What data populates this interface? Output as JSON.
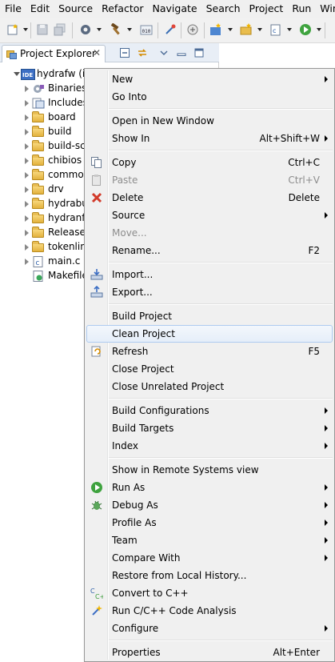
{
  "menubar": [
    "File",
    "Edit",
    "Source",
    "Refactor",
    "Navigate",
    "Search",
    "Project",
    "Run",
    "Window"
  ],
  "explorer": {
    "tab_label": "Project Explorer",
    "close_glyph": "✕",
    "tree": [
      {
        "label": "hydrafw (in",
        "icon": "c-project-icon",
        "level": 0,
        "open": true
      },
      {
        "label": "Binaries",
        "icon": "binaries-icon",
        "level": 1
      },
      {
        "label": "Includes",
        "icon": "includes-icon",
        "level": 1
      },
      {
        "label": "board",
        "icon": "folder-icon",
        "level": 1
      },
      {
        "label": "build",
        "icon": "folder-icon",
        "level": 1
      },
      {
        "label": "build-sc",
        "icon": "folder-icon",
        "level": 1
      },
      {
        "label": "chibios",
        "icon": "folder-icon",
        "level": 1
      },
      {
        "label": "commor",
        "icon": "folder-icon",
        "level": 1
      },
      {
        "label": "drv",
        "icon": "folder-icon",
        "level": 1
      },
      {
        "label": "hydrabu",
        "icon": "folder-icon",
        "level": 1
      },
      {
        "label": "hydranfc",
        "icon": "folder-icon",
        "level": 1
      },
      {
        "label": "Release",
        "icon": "folder-icon",
        "level": 1
      },
      {
        "label": "tokenlin",
        "icon": "folder-icon",
        "level": 1
      },
      {
        "label": "main.c",
        "icon": "c-file-icon",
        "level": 1
      },
      {
        "label": "Makefile",
        "icon": "makefile-icon",
        "level": 1,
        "no_twist": true
      }
    ]
  },
  "context_menu": {
    "items": [
      {
        "type": "item",
        "label": "New",
        "submenu": true
      },
      {
        "type": "item",
        "label": "Go Into"
      },
      {
        "type": "sep"
      },
      {
        "type": "item",
        "label": "Open in New Window"
      },
      {
        "type": "item",
        "label": "Show In",
        "shortcut": "Alt+Shift+W",
        "submenu": true
      },
      {
        "type": "sep"
      },
      {
        "type": "item",
        "label": "Copy",
        "shortcut": "Ctrl+C",
        "icon": "copy-icon"
      },
      {
        "type": "item",
        "label": "Paste",
        "shortcut": "Ctrl+V",
        "icon": "paste-icon",
        "disabled": true
      },
      {
        "type": "item",
        "label": "Delete",
        "shortcut": "Delete",
        "icon": "delete-icon"
      },
      {
        "type": "item",
        "label": "Source",
        "submenu": true
      },
      {
        "type": "item",
        "label": "Move...",
        "disabled": true
      },
      {
        "type": "item",
        "label": "Rename...",
        "shortcut": "F2"
      },
      {
        "type": "sep"
      },
      {
        "type": "item",
        "label": "Import...",
        "icon": "import-icon"
      },
      {
        "type": "item",
        "label": "Export...",
        "icon": "export-icon"
      },
      {
        "type": "sep"
      },
      {
        "type": "item",
        "label": "Build Project"
      },
      {
        "type": "item",
        "label": "Clean Project",
        "highlighted": true
      },
      {
        "type": "item",
        "label": "Refresh",
        "shortcut": "F5",
        "icon": "refresh-icon"
      },
      {
        "type": "item",
        "label": "Close Project"
      },
      {
        "type": "item",
        "label": "Close Unrelated Project"
      },
      {
        "type": "sep"
      },
      {
        "type": "item",
        "label": "Build Configurations",
        "submenu": true
      },
      {
        "type": "item",
        "label": "Build Targets",
        "submenu": true
      },
      {
        "type": "item",
        "label": "Index",
        "submenu": true
      },
      {
        "type": "sep"
      },
      {
        "type": "item",
        "label": "Show in Remote Systems view"
      },
      {
        "type": "item",
        "label": "Run As",
        "submenu": true,
        "icon": "run-icon"
      },
      {
        "type": "item",
        "label": "Debug As",
        "submenu": true,
        "icon": "debug-icon"
      },
      {
        "type": "item",
        "label": "Profile As",
        "submenu": true
      },
      {
        "type": "item",
        "label": "Team",
        "submenu": true
      },
      {
        "type": "item",
        "label": "Compare With",
        "submenu": true
      },
      {
        "type": "item",
        "label": "Restore from Local History..."
      },
      {
        "type": "item",
        "label": "Convert to C++",
        "icon": "convert-cpp-icon"
      },
      {
        "type": "item",
        "label": "Run C/C++ Code Analysis",
        "icon": "code-analysis-icon"
      },
      {
        "type": "item",
        "label": "Configure",
        "submenu": true
      },
      {
        "type": "sep"
      },
      {
        "type": "item",
        "label": "Properties",
        "shortcut": "Alt+Enter"
      }
    ]
  }
}
